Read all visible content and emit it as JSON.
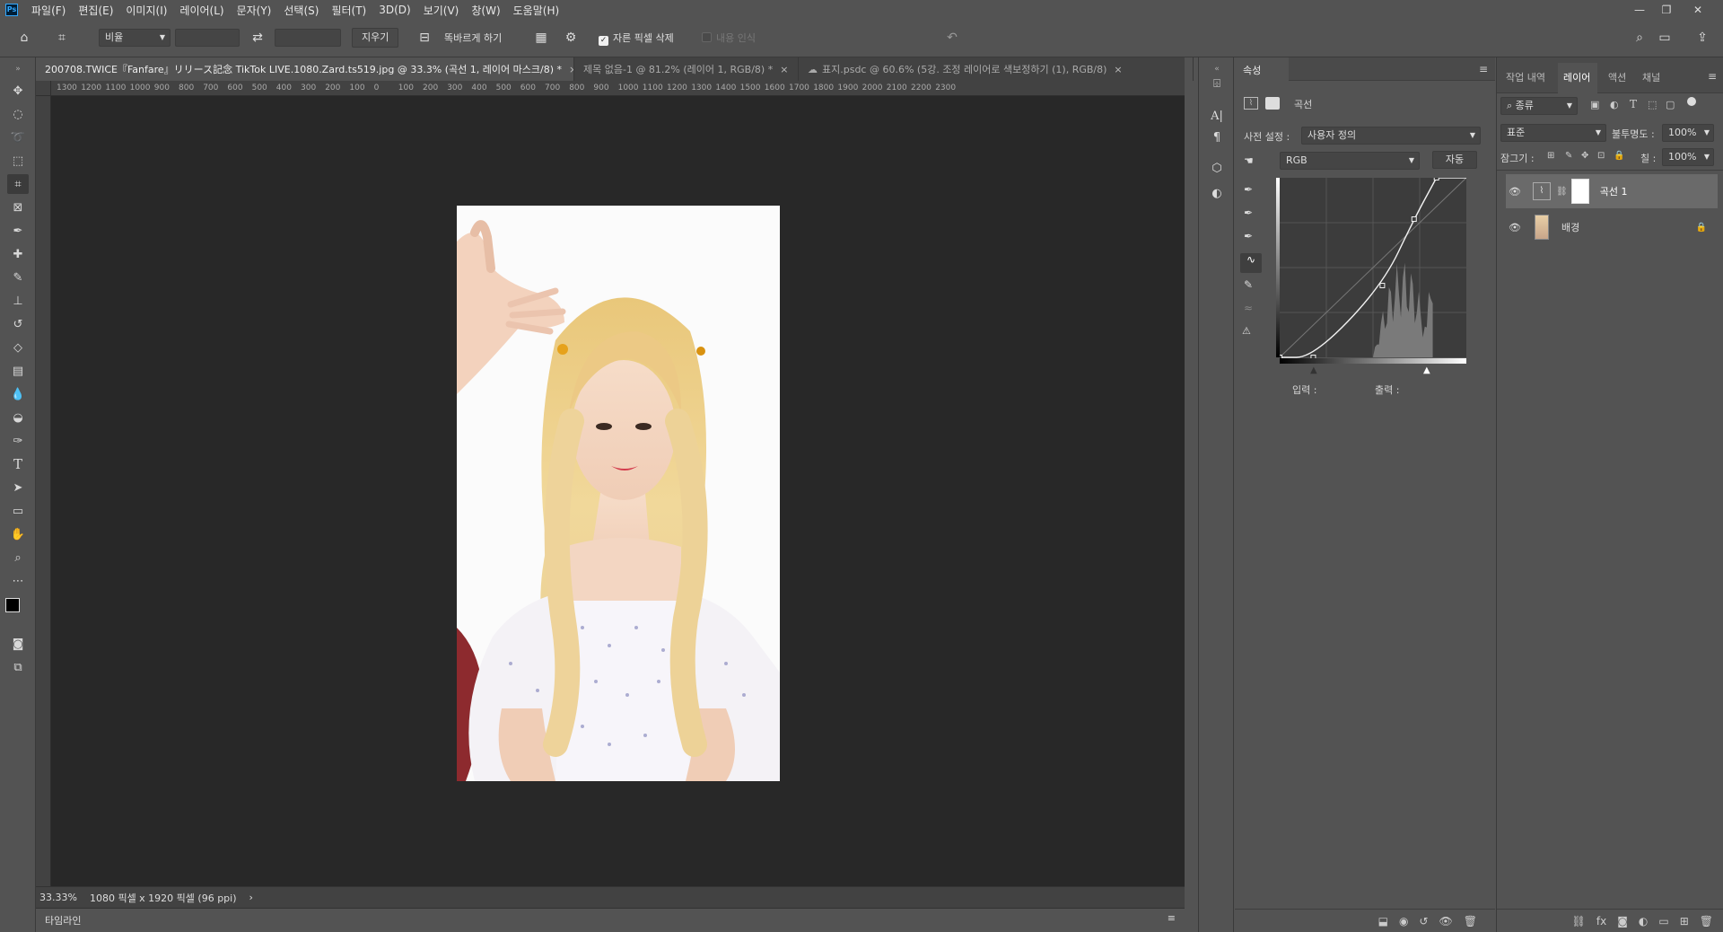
{
  "menubar": {
    "logo": "Ps",
    "items": [
      "파일(F)",
      "편집(E)",
      "이미지(I)",
      "레이어(L)",
      "문자(Y)",
      "선택(S)",
      "필터(T)",
      "3D(D)",
      "보기(V)",
      "창(W)",
      "도움말(H)"
    ],
    "window_controls": [
      "minimize-icon",
      "restore-icon",
      "close-icon"
    ]
  },
  "options": {
    "ratio_select": "비율",
    "clear_button": "지우기",
    "straighten_label": "똑바르게 하기",
    "delete_cropped": "자른 픽셀 삭제",
    "delete_cropped_checked": true,
    "content_aware": "내용 인식",
    "content_aware_checked": false
  },
  "tabs": [
    {
      "label": "200708.TWICE『Fanfare』リリース記念 TikTok LIVE.1080.Zard.ts519.jpg @ 33.3% (곡선 1, 레이어 마스크/8) *",
      "active": true
    },
    {
      "label": "제목 없음-1 @ 81.2% (레이어 1, RGB/8) *",
      "active": false
    },
    {
      "label": "표지.psdc @ 60.6% (5강. 조정 레이어로 색보정하기 (1), RGB/8)",
      "active": false,
      "cloud": true
    }
  ],
  "ruler_ticks": [
    "1300",
    "1200",
    "1100",
    "1000",
    "900",
    "800",
    "700",
    "600",
    "500",
    "400",
    "300",
    "200",
    "100",
    "0",
    "100",
    "200",
    "300",
    "400",
    "500",
    "600",
    "700",
    "800",
    "900",
    "1000",
    "1100",
    "1200",
    "1300",
    "1400",
    "1500",
    "1600",
    "1700",
    "1800",
    "1900",
    "2000",
    "2100",
    "2200",
    "2300"
  ],
  "status": {
    "zoom": "33.33%",
    "doc_info": "1080 픽셀 x 1920 픽셀 (96 ppi)"
  },
  "timeline": {
    "label": "타임라인"
  },
  "properties": {
    "tab_label": "속성",
    "adjustment_name": "곡선",
    "preset_label": "사전 설정 :",
    "preset_value": "사용자 정의",
    "channel": "RGB",
    "auto_button": "자동",
    "input_label": "입력 :",
    "output_label": "출력 :"
  },
  "layers_panel": {
    "tabs": [
      {
        "label": "작업 내역",
        "active": false
      },
      {
        "label": "레이어",
        "active": true
      },
      {
        "label": "액션",
        "active": false
      },
      {
        "label": "채널",
        "active": false
      }
    ],
    "filter_kind": "종류",
    "blend_mode": "표준",
    "opacity_label": "불투명도 :",
    "opacity_value": "100%",
    "lock_label": "잠그기 :",
    "fill_label": "칠 :",
    "fill_value": "100%",
    "layers": [
      {
        "name": "곡선 1",
        "type": "adjustment",
        "selected": true
      },
      {
        "name": "배경",
        "type": "background",
        "selected": false
      }
    ]
  },
  "curve": {
    "points": [
      [
        0,
        0
      ],
      [
        18,
        0
      ],
      [
        55,
        40
      ],
      [
        72,
        77
      ],
      [
        84,
        100
      ]
    ],
    "histogram_peak_range": [
      50,
      82
    ]
  }
}
